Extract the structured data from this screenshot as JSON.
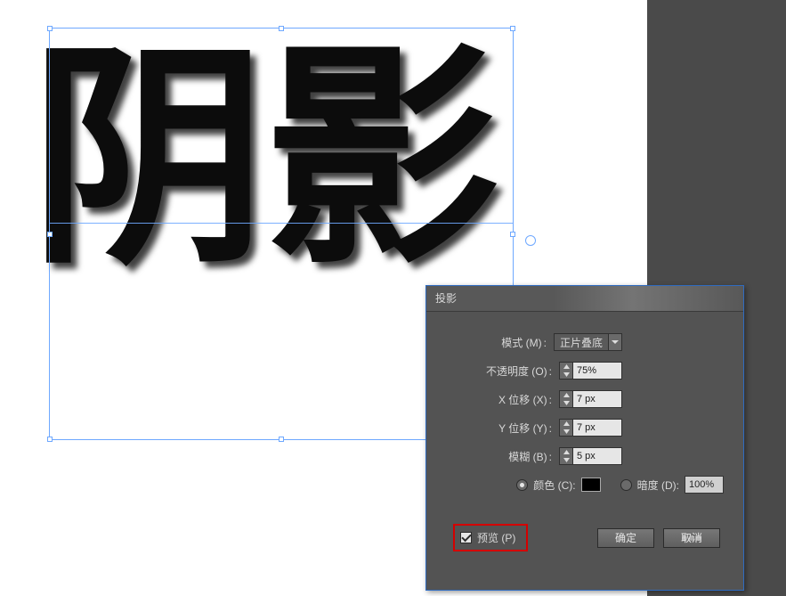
{
  "canvas": {
    "text": "阴影"
  },
  "dialog": {
    "title": "投影",
    "mode": {
      "label": "模式",
      "hotkey": "M",
      "value": "正片叠底"
    },
    "opacity": {
      "label": "不透明度",
      "hotkey": "O",
      "value": "75%"
    },
    "x_offset": {
      "label": "X 位移",
      "hotkey": "X",
      "value": "7 px"
    },
    "y_offset": {
      "label": "Y 位移",
      "hotkey": "Y",
      "value": "7 px"
    },
    "blur": {
      "label": "模糊",
      "hotkey": "B",
      "value": "5 px"
    },
    "color": {
      "label": "颜色",
      "hotkey": "C",
      "selected": true,
      "swatch": "#000000"
    },
    "darkness": {
      "label": "暗度",
      "hotkey": "D",
      "selected": false,
      "value": "100%"
    },
    "preview": {
      "label": "预览",
      "hotkey": "P",
      "checked": true
    },
    "buttons": {
      "ok": "确定",
      "cancel": "取消"
    }
  }
}
